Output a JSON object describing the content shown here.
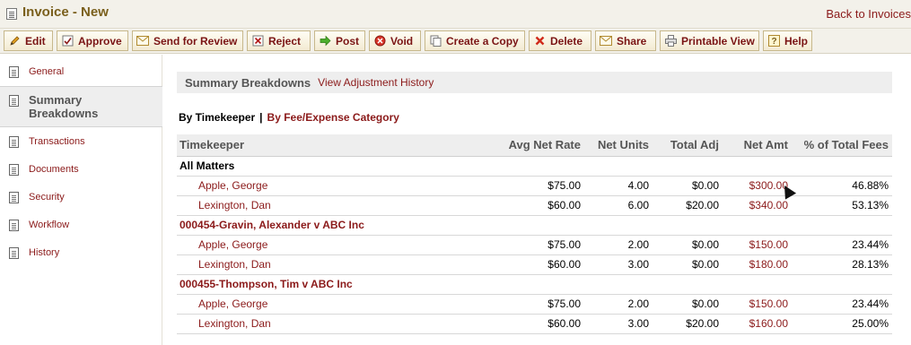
{
  "window": {
    "title": "Invoice - New",
    "back_link": "Back to Invoices"
  },
  "toolbar": [
    {
      "label": "Edit",
      "icon": "pencil-icon"
    },
    {
      "label": "Approve",
      "icon": "approve-icon"
    },
    {
      "label": "Send for Review",
      "icon": "envelope-icon"
    },
    {
      "label": "Reject",
      "icon": "reject-icon"
    },
    {
      "label": "Post",
      "icon": "arrow-right-icon"
    },
    {
      "label": "Void",
      "icon": "void-icon"
    },
    {
      "label": "Create a Copy",
      "icon": "copy-icon"
    },
    {
      "label": "Delete",
      "icon": "delete-x-icon"
    },
    {
      "label": "Share",
      "icon": "envelope-icon"
    },
    {
      "label": "Printable View",
      "icon": "printer-icon"
    },
    {
      "label": "Help",
      "icon": "help-icon"
    }
  ],
  "sidebar": {
    "items": [
      {
        "label": "General"
      },
      {
        "label": "Summary Breakdowns",
        "active": true
      },
      {
        "label": "Transactions"
      },
      {
        "label": "Documents"
      },
      {
        "label": "Security"
      },
      {
        "label": "Workflow"
      },
      {
        "label": "History"
      }
    ]
  },
  "section": {
    "title": "Summary Breakdowns",
    "link": "View Adjustment History"
  },
  "breakdown_toggle": {
    "current": "By Timekeeper",
    "separator": "|",
    "other": "By Fee/Expense Category"
  },
  "table": {
    "columns": [
      "Timekeeper",
      "Avg Net Rate",
      "Net Units",
      "Total Adj",
      "Net Amt",
      "% of Total Fees"
    ],
    "groups": [
      {
        "label": "All Matters",
        "style": "black",
        "rows": [
          {
            "name": "Apple, George",
            "rate": "$75.00",
            "units": "4.00",
            "adj": "$0.00",
            "amt": "$300.00",
            "pct": "46.88%"
          },
          {
            "name": "Lexington, Dan",
            "rate": "$60.00",
            "units": "6.00",
            "adj": "$20.00",
            "amt": "$340.00",
            "pct": "53.13%"
          }
        ]
      },
      {
        "label": "000454-Gravin, Alexander v ABC Inc",
        "style": "red",
        "rows": [
          {
            "name": "Apple, George",
            "rate": "$75.00",
            "units": "2.00",
            "adj": "$0.00",
            "amt": "$150.00",
            "pct": "23.44%"
          },
          {
            "name": "Lexington, Dan",
            "rate": "$60.00",
            "units": "3.00",
            "adj": "$0.00",
            "amt": "$180.00",
            "pct": "28.13%"
          }
        ]
      },
      {
        "label": "000455-Thompson, Tim v ABC Inc",
        "style": "red",
        "rows": [
          {
            "name": "Apple, George",
            "rate": "$75.00",
            "units": "2.00",
            "adj": "$0.00",
            "amt": "$150.00",
            "pct": "23.44%"
          },
          {
            "name": "Lexington, Dan",
            "rate": "$60.00",
            "units": "3.00",
            "adj": "$20.00",
            "amt": "$160.00",
            "pct": "25.00%"
          }
        ]
      }
    ]
  },
  "colors": {
    "link": "#8b1a1a",
    "title": "#7a5f1c",
    "header_bg": "#eeeeee",
    "toolbar_bg": "#f3f1ea"
  }
}
